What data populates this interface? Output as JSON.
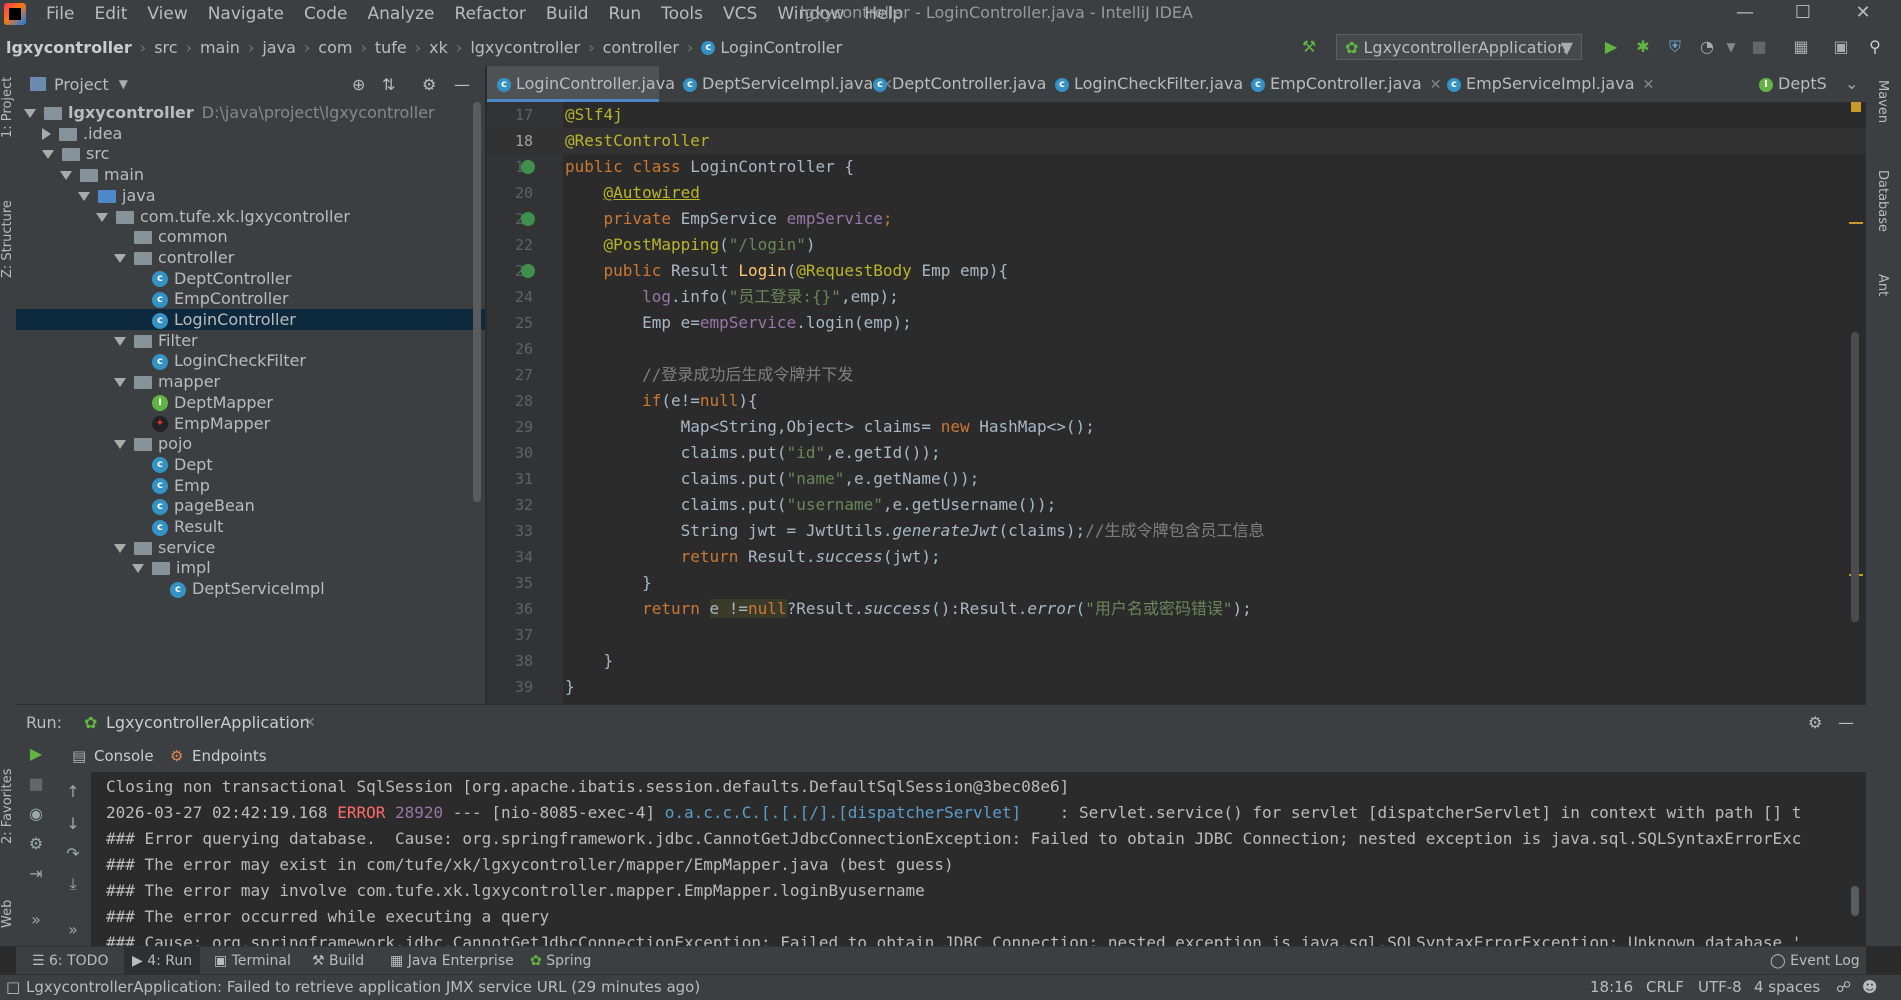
{
  "menu": [
    "File",
    "Edit",
    "View",
    "Navigate",
    "Code",
    "Analyze",
    "Refactor",
    "Build",
    "Run",
    "Tools",
    "VCS",
    "Window",
    "Help"
  ],
  "window_title": "lgxycontroller - LoginController.java - IntelliJ IDEA",
  "breadcrumbs": [
    "lgxycontroller",
    "src",
    "main",
    "java",
    "com",
    "tufe",
    "xk",
    "lgxycontroller",
    "controller",
    "LoginController"
  ],
  "run_config": "LgxycontrollerApplication",
  "stripe_left": [
    "1: Project",
    "Z: Structure"
  ],
  "stripe_left_bottom": [
    "2: Favorites",
    "Web"
  ],
  "stripe_right": [
    "Maven",
    "Database",
    "Ant"
  ],
  "project": {
    "title": "Project",
    "root_name": "lgxycontroller",
    "root_path": "D:\\java\\project\\lgxycontroller",
    "items": [
      {
        "label": "lgxycontroller",
        "type": "root",
        "level": 0,
        "open": true
      },
      {
        "label": ".idea",
        "type": "folder",
        "level": 1,
        "open": false
      },
      {
        "label": "src",
        "type": "folder",
        "level": 1,
        "open": true
      },
      {
        "label": "main",
        "type": "folder",
        "level": 2,
        "open": true
      },
      {
        "label": "java",
        "type": "folder-blue",
        "level": 3,
        "open": true
      },
      {
        "label": "com.tufe.xk.lgxycontroller",
        "type": "package",
        "level": 4,
        "open": true
      },
      {
        "label": "common",
        "type": "package",
        "level": 5,
        "open": null
      },
      {
        "label": "controller",
        "type": "package",
        "level": 5,
        "open": true
      },
      {
        "label": "DeptController",
        "type": "class",
        "level": 6
      },
      {
        "label": "EmpController",
        "type": "class",
        "level": 6
      },
      {
        "label": "LoginController",
        "type": "class",
        "level": 6,
        "selected": true
      },
      {
        "label": "Filter",
        "type": "package",
        "level": 5,
        "open": true
      },
      {
        "label": "LoginCheckFilter",
        "type": "class",
        "level": 6
      },
      {
        "label": "mapper",
        "type": "package",
        "level": 5,
        "open": true
      },
      {
        "label": "DeptMapper",
        "type": "interface",
        "level": 6
      },
      {
        "label": "EmpMapper",
        "type": "mapper",
        "level": 6
      },
      {
        "label": "pojo",
        "type": "package",
        "level": 5,
        "open": true
      },
      {
        "label": "Dept",
        "type": "class",
        "level": 6
      },
      {
        "label": "Emp",
        "type": "class",
        "level": 6
      },
      {
        "label": "pageBean",
        "type": "class",
        "level": 6
      },
      {
        "label": "Result",
        "type": "class",
        "level": 6
      },
      {
        "label": "service",
        "type": "package",
        "level": 5,
        "open": true
      },
      {
        "label": "impl",
        "type": "package",
        "level": 6,
        "open": true
      },
      {
        "label": "DeptServiceImpl",
        "type": "class",
        "level": 7
      }
    ]
  },
  "editor_tabs": [
    "LoginController.java",
    "DeptServiceImpl.java",
    "DeptController.java",
    "LoginCheckFilter.java",
    "EmpController.java",
    "EmpServiceImpl.java",
    "DeptS"
  ],
  "code": {
    "line_numbers": [
      "17",
      "18",
      "19",
      "20",
      "21",
      "22",
      "23",
      "24",
      "25",
      "26",
      "27",
      "28",
      "29",
      "30",
      "31",
      "32",
      "33",
      "34",
      "35",
      "36",
      "37",
      "38",
      "39"
    ],
    "t": {
      "slf4j": "@Slf4j",
      "rest": "@RestController",
      "public": "public",
      "class": "class",
      "login_controller": "LoginController {",
      "autowired": "@Autowired",
      "private": "private",
      "emp_service_type": "EmpService",
      "emp_service": "empService",
      "semi": ";",
      "post": "@PostMapping",
      "lparen": "(",
      "login_path": "\"/login\"",
      "rparen": ")",
      "result": "Result",
      "login_fn": "Login",
      "reqbody": "@RequestBody",
      "emp_param": "Emp emp){",
      "log": "log",
      "info": ".info(",
      "log_msg": "\"员工登录:{}\"",
      "emp_end": ",emp);",
      "emp_e": "Emp e=",
      "login_call": ".login(emp);",
      "comment1": "//登录成功后生成令牌并下发",
      "if": "if",
      "if_cond": "(e!=",
      "null": "null",
      "if_end": "){",
      "map_decl": "Map<String,Object> claims= ",
      "new": "new",
      "hashmap": " HashMap<>();",
      "put": "claims.put(",
      "id_key": "\"id\"",
      "get_id": ",e.getId());",
      "name_key": "\"name\"",
      "get_name": ",e.getName());",
      "username_key": "\"username\"",
      "get_username": ",e.getUsername());",
      "jwt_decl": "String jwt = JwtUtils.",
      "generate": "generateJwt",
      "claims_end": "(claims);",
      "comment2": "//生成令牌包含员工信息",
      "return": "return",
      "result_dot": " Result.",
      "success": "success",
      "jwt_end": "(jwt);",
      "e_ne": "e !=",
      "ternary": "?Result.",
      "success_else": "():Result.",
      "error": "error",
      "err_msg": "\"用户名或密码错误\"",
      "end_stmt": ");",
      "close": "}"
    }
  },
  "run": {
    "label": "Run:",
    "app_tab": "LgxycontrollerApplication",
    "subtabs": [
      "Console",
      "Endpoints"
    ],
    "console": {
      "l1": "Closing non transactional SqlSession [org.apache.ibatis.session.defaults.DefaultSqlSession@3bec08e6]",
      "l2_ts": "2026-03-27 02:42:19.168 ",
      "l2_level": "ERROR",
      "l2_pid": " 28920",
      "l2_mid": " --- [nio-8085-exec-4] ",
      "l2_logger": "o.a.c.c.C.[.[.[/].[dispatcherServlet]",
      "l2_msg": "    : Servlet.service() for servlet [dispatcherServlet] in context with path [] t",
      "l3": "### Error querying database.  Cause: org.springframework.jdbc.CannotGetJdbcConnectionException: Failed to obtain JDBC Connection; nested exception is java.sql.SQLSyntaxErrorExc",
      "l4": "### The error may exist in com/tufe/xk/lgxycontroller/mapper/EmpMapper.java (best guess)",
      "l5": "### The error may involve com.tufe.xk.lgxycontroller.mapper.EmpMapper.loginByusername",
      "l6": "### The error occurred while executing a query",
      "l7": "### Cause: org.springframework.jdbc.CannotGetJdbcConnectionException: Failed to obtain JDBC Connection; nested exception is java.sql.SQLSyntaxErrorException: Unknown database '"
    }
  },
  "tool_tabs": [
    "6: TODO",
    "4: Run",
    "Terminal",
    "Build",
    "Java Enterprise",
    "Spring"
  ],
  "event_log": "Event Log",
  "status": {
    "message": "LgxycontrollerApplication: Failed to retrieve application JMX service URL (29 minutes ago)",
    "position": "18:16",
    "line_sep": "CRLF",
    "encoding": "UTF-8",
    "indent": "4 spaces"
  },
  "colors": {
    "accent": "#4a88c7",
    "selection": "#0d293e",
    "error": "#ff6b68",
    "keyword": "#cc7832",
    "string": "#6a8759",
    "annotation": "#bbb529"
  }
}
